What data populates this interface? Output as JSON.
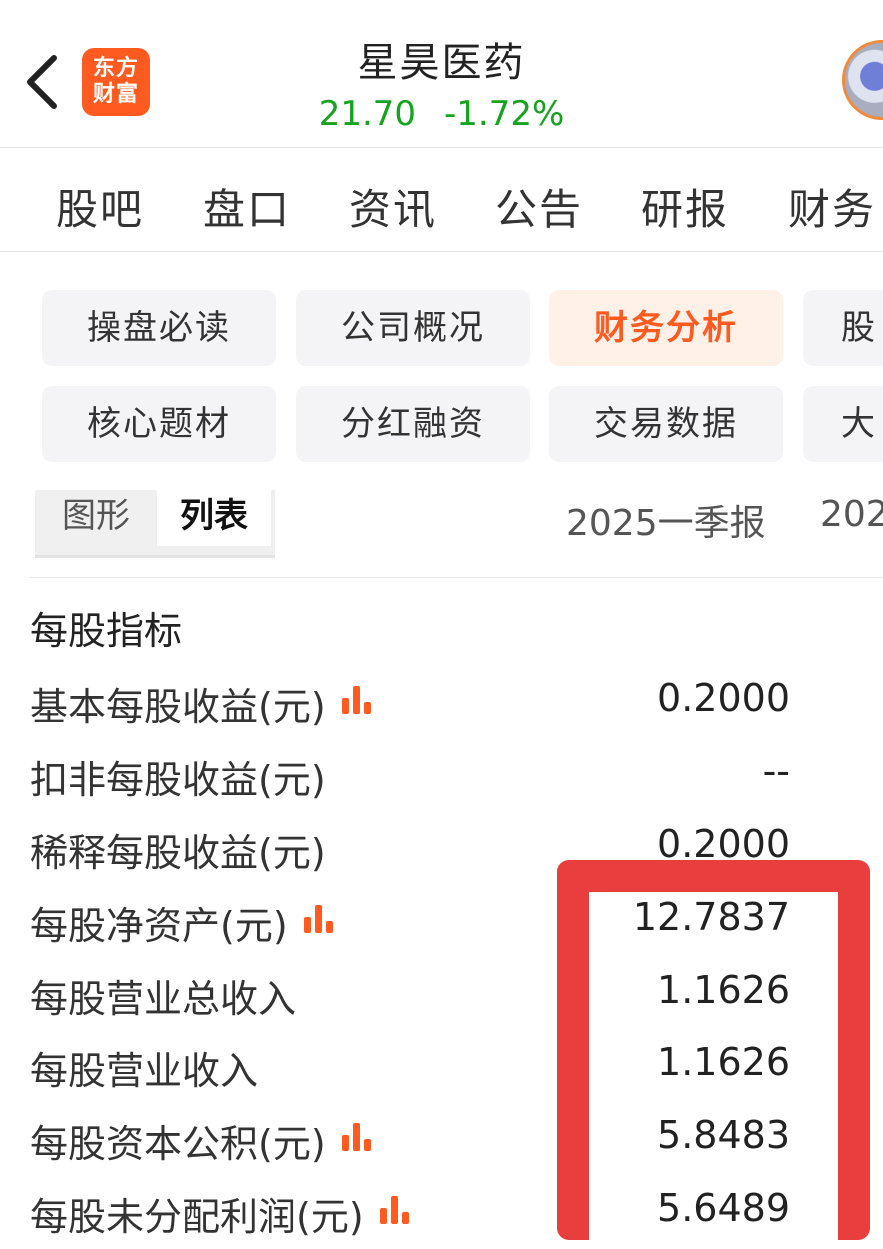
{
  "header": {
    "logo_line1": "东方",
    "logo_line2": "财富",
    "stock_name": "星昊医药",
    "price": "21.70",
    "change_pct": "-1.72%",
    "price_color": "#16a31f"
  },
  "main_tabs": [
    "股吧",
    "盘口",
    "资讯",
    "公告",
    "研报",
    "财务"
  ],
  "chips_row1": [
    "操盘必读",
    "公司概况",
    "财务分析",
    "股"
  ],
  "chips_row2": [
    "核心题材",
    "分红融资",
    "交易数据",
    "大"
  ],
  "active_chip": "财务分析",
  "view_toggle": {
    "graph": "图形",
    "list": "列表",
    "selected": "列表"
  },
  "periods": [
    "2025一季报",
    "202"
  ],
  "table": {
    "section_title": "每股指标",
    "rows": [
      {
        "label": "基本每股收益(元)",
        "value": "0.2000",
        "chart_icon": true
      },
      {
        "label": "扣非每股收益(元)",
        "value": "--",
        "chart_icon": false
      },
      {
        "label": "稀释每股收益(元)",
        "value": "0.2000",
        "chart_icon": false
      },
      {
        "label": "每股净资产(元)",
        "value": "12.7837",
        "chart_icon": true
      },
      {
        "label": "每股营业总收入",
        "value": "1.1626",
        "chart_icon": false
      },
      {
        "label": "每股营业收入",
        "value": "1.1626",
        "chart_icon": false
      },
      {
        "label": "每股资本公积(元)",
        "value": "5.8483",
        "chart_icon": true
      },
      {
        "label": "每股未分配利润(元)",
        "value": "5.6489",
        "chart_icon": true
      }
    ]
  },
  "colors": {
    "accent": "#ff5a1f",
    "highlight": "#e83e3e"
  }
}
